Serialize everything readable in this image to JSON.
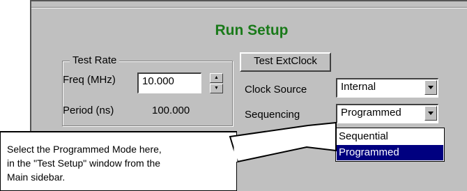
{
  "window": {
    "title": "Run Setup"
  },
  "test_rate": {
    "legend": "Test Rate",
    "freq_label": "Freq (MHz)",
    "freq_value": "10.000",
    "period_label": "Period (ns)",
    "period_value": "100.000"
  },
  "buttons": {
    "test_extclock": "Test ExtClock"
  },
  "clock_source": {
    "label": "Clock Source",
    "value": "Internal"
  },
  "sequencing": {
    "label": "Sequencing",
    "value": "Programmed",
    "options": [
      "Sequential",
      "Programmed"
    ],
    "highlighted": "Programmed"
  },
  "callout": {
    "lines": [
      "Select the Programmed Mode here,",
      "in the \"Test Setup\" window from the",
      "Main sidebar."
    ]
  },
  "colors": {
    "title": "#1a7a1a",
    "panel": "#c0c0c0",
    "selection": "#000080"
  }
}
